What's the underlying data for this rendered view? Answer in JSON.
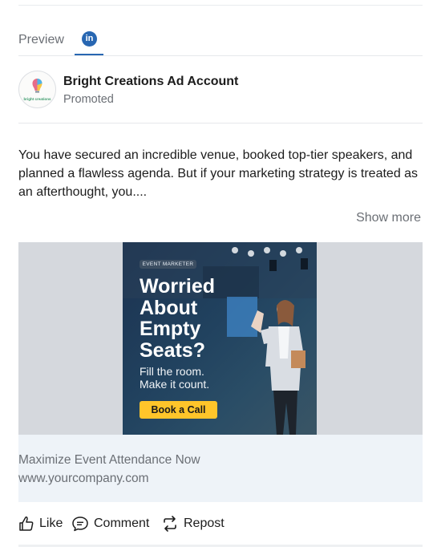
{
  "tabs": {
    "preview": "Preview",
    "linkedin_glyph": "in"
  },
  "account": {
    "name": "Bright Creations Ad Account",
    "subtitle": "Promoted",
    "logo_text": "bright creations"
  },
  "post": {
    "text": "You have secured an incredible venue, booked top-tier speakers, and planned a flawless agenda. But if your marketing strategy is treated as an afterthought, you....",
    "show_more": "Show more"
  },
  "creative": {
    "badge": "EVENT MARKETER",
    "headline": "Worried About Empty Seats?",
    "subline": "Fill the room. Make it count.",
    "cta": "Book a Call"
  },
  "ad": {
    "headline": "Maximize Event Attendance Now",
    "url": "www.yourcompany.com"
  },
  "actions": {
    "like": "Like",
    "comment": "Comment",
    "repost": "Repost"
  },
  "colors": {
    "linkedin_blue": "#2867b2",
    "cta_yellow": "#ffc52a",
    "creative_bg": "#1c3250",
    "caption_bg": "#eef3f8"
  }
}
